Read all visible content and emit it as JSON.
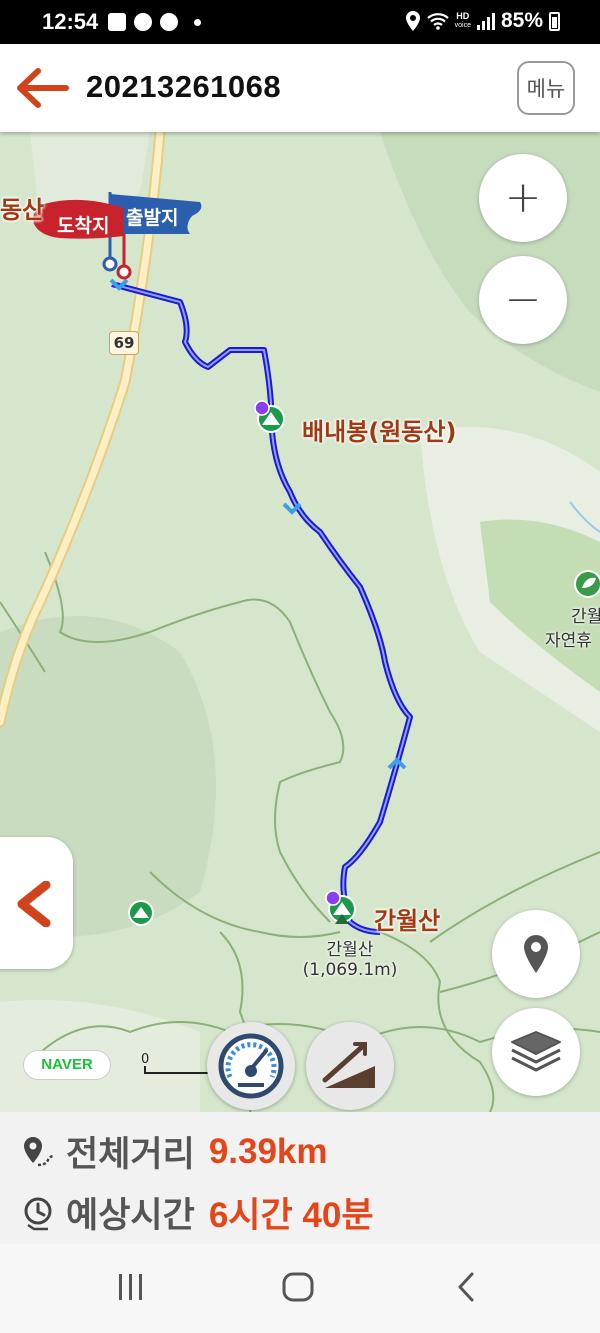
{
  "status_bar": {
    "time": "12:54",
    "notification_icons": [
      "gallery-icon",
      "kakaotalk-icon",
      "music-icon",
      "dot-icon"
    ],
    "system_icons": [
      "location-icon",
      "wifi-icon",
      "hd-voice-icon",
      "signal-icon",
      "battery-icon"
    ],
    "hd_voice": "HD",
    "hd_voice_sub": "voice",
    "battery": "85%"
  },
  "app_bar": {
    "back_icon": "back-arrow-icon",
    "title": "20213261068",
    "menu_label": "메뉴"
  },
  "map": {
    "labels": {
      "top_left_partial": "동산",
      "peak_1": "배내봉(원동산)",
      "peak_2": "간월산",
      "peak_2_name": "간월산",
      "peak_2_elevation": "(1,069.1m)",
      "right_partial_1": "간월",
      "right_partial_2": "자연휴"
    },
    "flags": {
      "arrival": "도착지",
      "departure": "출발지"
    },
    "road_number": "69",
    "provider": "NAVER",
    "scale_zero": "0",
    "controls": {
      "zoom_in": "+",
      "zoom_out": "−"
    },
    "route_color": "#1a1ad6",
    "arrival_flag_color": "#c8232c",
    "departure_flag_color": "#2b5fae",
    "peak_marker_color": "#1a9a4a"
  },
  "summary": {
    "distance_label": "전체거리",
    "distance_value": "9.39km",
    "time_label": "예상시간",
    "time_value": "6시간 40분",
    "value_color": "#e4461a"
  }
}
